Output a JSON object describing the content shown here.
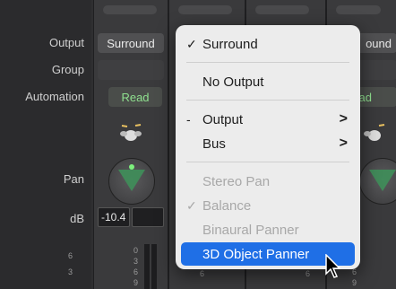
{
  "labels": {
    "output": "Output",
    "group": "Group",
    "automation": "Automation",
    "pan": "Pan",
    "db": "dB"
  },
  "channel": {
    "output_value": "Surround",
    "automation_value": "Read",
    "db_value": "-10.4"
  },
  "right_strip": {
    "output_value": "ound",
    "automation_value": "ead"
  },
  "meter_ticks": {
    "left": [
      "6",
      "3"
    ],
    "strip": [
      "0",
      "3",
      "6",
      "9"
    ]
  },
  "menu": {
    "items": [
      {
        "check": "✓",
        "label": "Surround",
        "arrow": "",
        "state": "normal"
      },
      {
        "check": "",
        "label": "No Output",
        "arrow": "",
        "state": "normal"
      },
      {
        "check": "-",
        "label": "Output",
        "arrow": ">",
        "state": "normal"
      },
      {
        "check": "",
        "label": "Bus",
        "arrow": ">",
        "state": "normal"
      },
      {
        "check": "",
        "label": "Stereo Pan",
        "arrow": "",
        "state": "disabled"
      },
      {
        "check": "✓",
        "label": "Balance",
        "arrow": "",
        "state": "disabled"
      },
      {
        "check": "",
        "label": "Binaural Panner",
        "arrow": "",
        "state": "disabled"
      },
      {
        "check": "",
        "label": "3D Object Panner",
        "arrow": "",
        "state": "highlighted"
      }
    ]
  },
  "colors": {
    "highlight": "#1f6fe6",
    "read_green": "#8fe08f",
    "pan_green": "#3f8f5a"
  }
}
